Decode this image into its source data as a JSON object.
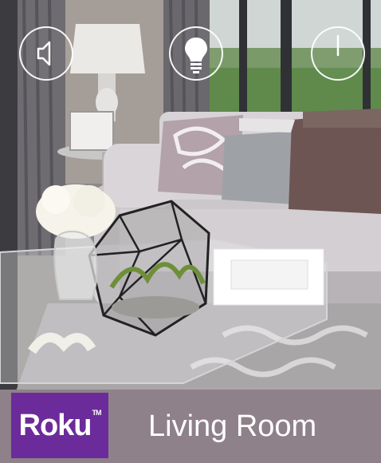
{
  "controls": {
    "volume": {
      "icon": "speaker-icon"
    },
    "light": {
      "icon": "lightbulb-icon"
    },
    "power": {
      "icon": "power-icon"
    }
  },
  "footer": {
    "logo_text": "Roku",
    "room_name": "Living Room"
  },
  "colors": {
    "footer_bg": "#8e8189",
    "logo_bg": "#6c2b9b",
    "icon_stroke": "#ffffff"
  }
}
